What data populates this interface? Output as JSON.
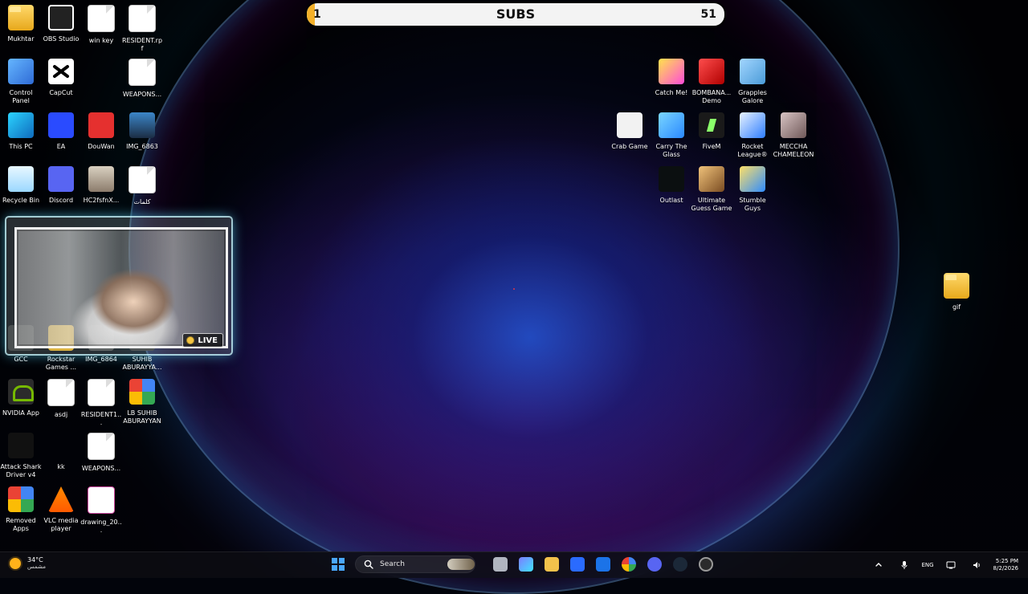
{
  "subs_bar": {
    "title": "SUBS",
    "left_value": "1",
    "right_value": "51",
    "progress": 0.02
  },
  "desktop": {
    "left_icons": [
      {
        "label": "Mukhtar",
        "type": "folder",
        "icon": "folder-icon"
      },
      {
        "label": "OBS Studio",
        "type": "app",
        "icon": "obs-icon"
      },
      {
        "label": "win key",
        "type": "doc",
        "icon": "file-icon"
      },
      {
        "label": "RESIDENT.rpf",
        "type": "doc",
        "icon": "file-icon"
      },
      {
        "label": "Control Panel",
        "type": "app",
        "icon": "control-panel-icon"
      },
      {
        "label": "CapCut",
        "type": "app",
        "icon": "capcut-icon"
      },
      {
        "label": "",
        "type": "blank",
        "icon": ""
      },
      {
        "label": "WEAPONS...",
        "type": "doc",
        "icon": "file-icon"
      },
      {
        "label": "This PC",
        "type": "app",
        "icon": "this-pc-icon"
      },
      {
        "label": "EA",
        "type": "app",
        "icon": "ea-icon"
      },
      {
        "label": "DouWan",
        "type": "app",
        "icon": "douwan-icon"
      },
      {
        "label": "IMG_6863",
        "type": "image",
        "icon": "image-icon"
      },
      {
        "label": "Recycle Bin",
        "type": "app",
        "icon": "recycle-bin-icon"
      },
      {
        "label": "Discord",
        "type": "app",
        "icon": "discord-icon"
      },
      {
        "label": "HC2fsfnX...",
        "type": "image",
        "icon": "image-icon"
      },
      {
        "label": "كلمات",
        "type": "doc",
        "icon": "file-icon"
      },
      {
        "label": "GCC",
        "type": "app",
        "icon": "gcc-icon"
      },
      {
        "label": "Rockstar Games ...",
        "type": "app",
        "icon": "rockstar-icon"
      },
      {
        "label": "IMG_6864",
        "type": "image",
        "icon": "image-icon"
      },
      {
        "label": "SUHIB ABURAYYA...",
        "type": "app",
        "icon": "app-icon"
      },
      {
        "label": "NVIDIA App",
        "type": "app",
        "icon": "nvidia-icon"
      },
      {
        "label": "asdj",
        "type": "doc",
        "icon": "file-icon"
      },
      {
        "label": "RESIDENT1...",
        "type": "doc",
        "icon": "file-icon"
      },
      {
        "label": "LB SUHIB ABURAYYAN",
        "type": "app",
        "icon": "chrome-icon"
      },
      {
        "label": "Attack Shark Driver v4",
        "type": "app",
        "icon": "attack-shark-icon"
      },
      {
        "label": "kk",
        "type": "blank",
        "icon": ""
      },
      {
        "label": "WEAPONS...",
        "type": "doc",
        "icon": "file-icon"
      },
      {
        "label": "",
        "type": "blank",
        "icon": ""
      },
      {
        "label": "Removed Apps",
        "type": "app",
        "icon": "chrome-icon"
      },
      {
        "label": "VLC media player",
        "type": "app",
        "icon": "vlc-icon"
      },
      {
        "label": "drawing_20...",
        "type": "image",
        "icon": "image-icon"
      },
      {
        "label": "",
        "type": "blank",
        "icon": ""
      }
    ],
    "right_icons": [
      {
        "label": "Catch Me!",
        "type": "app",
        "icon": "catch-me-icon"
      },
      {
        "label": "BOMBANA... Demo",
        "type": "app",
        "icon": "bombana-icon"
      },
      {
        "label": "Grapples Galore",
        "type": "app",
        "icon": "grapples-icon"
      },
      {
        "label": "Crab Game",
        "type": "app",
        "icon": "crab-game-icon"
      },
      {
        "label": "Carry The Glass",
        "type": "app",
        "icon": "carry-glass-icon"
      },
      {
        "label": "FiveM",
        "type": "app",
        "icon": "fivem-icon"
      },
      {
        "label": "Rocket League®",
        "type": "app",
        "icon": "rocket-league-icon"
      },
      {
        "label": "MECCHA CHAMELEON",
        "type": "app",
        "icon": "meccha-icon"
      },
      {
        "label": "Outlast",
        "type": "app",
        "icon": "outlast-icon"
      },
      {
        "label": "Ultimate Guess Game",
        "type": "app",
        "icon": "ultimate-guess-icon"
      },
      {
        "label": "Stumble Guys",
        "type": "app",
        "icon": "stumble-guys-icon"
      }
    ],
    "far_right_icons": [
      {
        "label": "gif",
        "type": "folder",
        "icon": "folder-icon"
      }
    ]
  },
  "webcam": {
    "live_label": "LIVE"
  },
  "taskbar": {
    "weather_temp": "34°C",
    "weather_desc": "مشمس",
    "search_placeholder": "Search",
    "tray": {
      "lang": "ENG",
      "time": "5:25 PM",
      "date": "8/2/2026"
    },
    "colors": {
      "taskbar_bg": "#0c0c12",
      "sun": "#ffb21a"
    }
  }
}
